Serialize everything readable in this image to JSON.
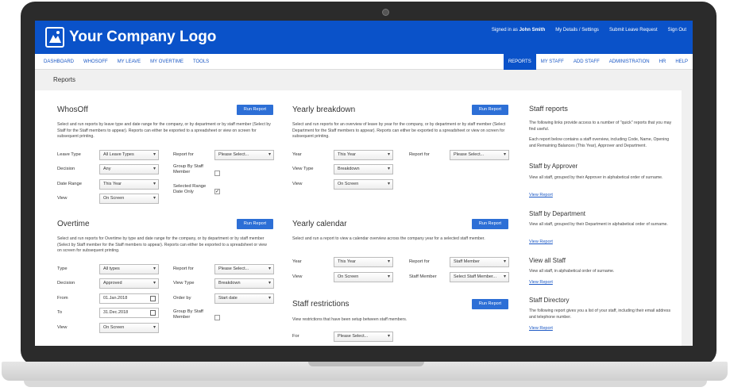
{
  "header": {
    "logo_text": "Your Company Logo",
    "signed_in_prefix": "Signed in as",
    "signed_in_user": "John Smith",
    "links": [
      "My Details / Settings",
      "Submit Leave Request",
      "Sign Out"
    ]
  },
  "nav": {
    "left": [
      "DASHBOARD",
      "WHOSOFF",
      "MY LEAVE",
      "MY OVERTIME",
      "TOOLS"
    ],
    "right": [
      "REPORTS",
      "MY STAFF",
      "ADD STAFF",
      "ADMINISTRATION",
      "HR",
      "HELP"
    ]
  },
  "page_title": "Reports",
  "run_label": "Run Report",
  "whosoff": {
    "title": "WhosOff",
    "desc": "Select and run reports by leave type and date range for the company, or by department or by staff member (Select by Staff for the Staff members to appear). Reports can either be exported to a spreadsheet or view on screen for subsequent printing.",
    "leave_type_label": "Leave Type",
    "leave_type": "All Leave Types",
    "decision_label": "Decision",
    "decision": "Any",
    "date_range_label": "Date Range",
    "date_range": "This Year",
    "view_label": "View",
    "view": "On Screen",
    "report_for_label": "Report for",
    "report_for": "Please Select...",
    "group_label": "Group By Staff Member",
    "selected_range_label": "Selected Range Date Only"
  },
  "overtime": {
    "title": "Overtime",
    "desc": "Select and run reports for Overtime by type and date range for the company, or by department or by staff member (Select by Staff member for the Staff members to appear). Reports can either be exported to a spreadsheet or view on screen for subsequent printing.",
    "type_label": "Type",
    "type": "All types",
    "decision_label": "Decision",
    "decision": "Approved",
    "from_label": "From",
    "from": "01.Jan.2018",
    "to_label": "To",
    "to": "31.Dec.2018",
    "view_label": "View",
    "view": "On Screen",
    "report_for_label": "Report for",
    "report_for": "Please Select...",
    "view_type_label": "View Type",
    "view_type": "Breakdown",
    "order_by_label": "Order by",
    "order_by": "Start date",
    "group_label": "Group By Staff Member"
  },
  "yearly_breakdown": {
    "title": "Yearly breakdown",
    "desc": "Select and run reports for an overview of leave by year for the company, or by department or by staff member (Select Department for the Staff members to appear). Reports can either be exported to a spreadsheet or view on screen for subsequent printing.",
    "year_label": "Year",
    "year": "This Year",
    "view_type_label": "View Type",
    "view_type": "Breakdown",
    "view_label": "View",
    "view": "On Screen",
    "report_for_label": "Report for",
    "report_for": "Please Select..."
  },
  "yearly_calendar": {
    "title": "Yearly calendar",
    "desc": "Select and run a report to view a calendar overview across the company year for a selected staff member.",
    "year_label": "Year",
    "year": "This Year",
    "view_label": "View",
    "view": "On Screen",
    "report_for_label": "Report for",
    "report_for": "Staff Member",
    "staff_member_label": "Staff Member",
    "staff_member": "Select Staff Member..."
  },
  "staff_restrictions": {
    "title": "Staff restrictions",
    "desc": "View restrictions that have been setup between staff members.",
    "for_label": "For",
    "for": "Please Select..."
  },
  "staff_reports": {
    "title": "Staff reports",
    "intro1": "The following links provide access to a number of \"quick\" reports that you may find useful.",
    "intro2": "Each report below contains a staff overview, including Code, Name, Opening and Remaining Balances (This Year), Approver and Department.",
    "link_label": "View Report",
    "items": [
      {
        "title": "Staff by Approver",
        "desc": "View all staff, grouped by their Approver in alphabetical order of surname."
      },
      {
        "title": "Staff by Department",
        "desc": "View all staff, grouped by their Department in alphabetical order of surname."
      },
      {
        "title": "View all Staff",
        "desc": "View all staff, in alphabetical order of surname."
      },
      {
        "title": "Staff Directory",
        "desc": "The following report gives you a list of your staff, including their email address and telephone number."
      }
    ]
  },
  "colors": {
    "brand": "#0a52c9",
    "button": "#2d6fd6",
    "link": "#1a57c4"
  }
}
